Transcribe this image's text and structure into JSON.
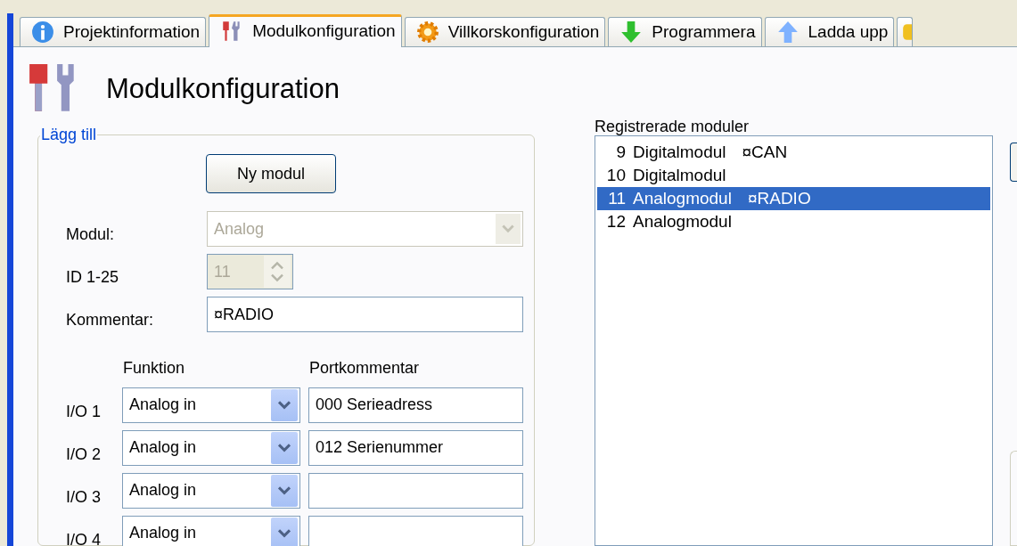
{
  "tabs": [
    {
      "label": "Projektinformation",
      "kind": "info",
      "selected": false
    },
    {
      "label": "Modulkonfiguration",
      "kind": "tools",
      "selected": true
    },
    {
      "label": "Villkorskonfiguration",
      "kind": "gear",
      "selected": false
    },
    {
      "label": "Programmera",
      "kind": "download",
      "selected": false
    },
    {
      "label": "Ladda upp",
      "kind": "upload",
      "selected": false
    },
    {
      "kind": "partial",
      "selected": false
    }
  ],
  "page_title": "Modulkonfiguration",
  "add_group": {
    "legend": "Lägg till",
    "new_button": "Ny modul",
    "module": {
      "label": "Modul:",
      "value": "Analog",
      "disabled": true
    },
    "id": {
      "label": "ID  1-25",
      "value": "11",
      "disabled": true
    },
    "comment": {
      "label": "Kommentar:",
      "value": "¤RADIO"
    },
    "function_header": "Funktion",
    "port_comment_header": "Portkommentar",
    "io_rows": [
      {
        "label": "I/O 1",
        "function": "Analog in",
        "comment": "000 Serieadress"
      },
      {
        "label": "I/O 2",
        "function": "Analog in",
        "comment": "012 Serienummer"
      },
      {
        "label": "I/O 3",
        "function": "Analog in"
      },
      {
        "label": "I/O 4",
        "function": "Analog in"
      }
    ]
  },
  "registered": {
    "label": "Registrerade moduler",
    "items": [
      {
        "id": "9",
        "name": "Digitalmodul",
        "comment": "¤CAN",
        "selected": false
      },
      {
        "id": "10",
        "name": "Digitalmodul",
        "selected": false
      },
      {
        "id": "11",
        "name": "Analogmodul",
        "comment": "¤RADIO",
        "selected": true
      },
      {
        "id": "12",
        "name": "Analogmodul",
        "selected": false
      }
    ]
  }
}
